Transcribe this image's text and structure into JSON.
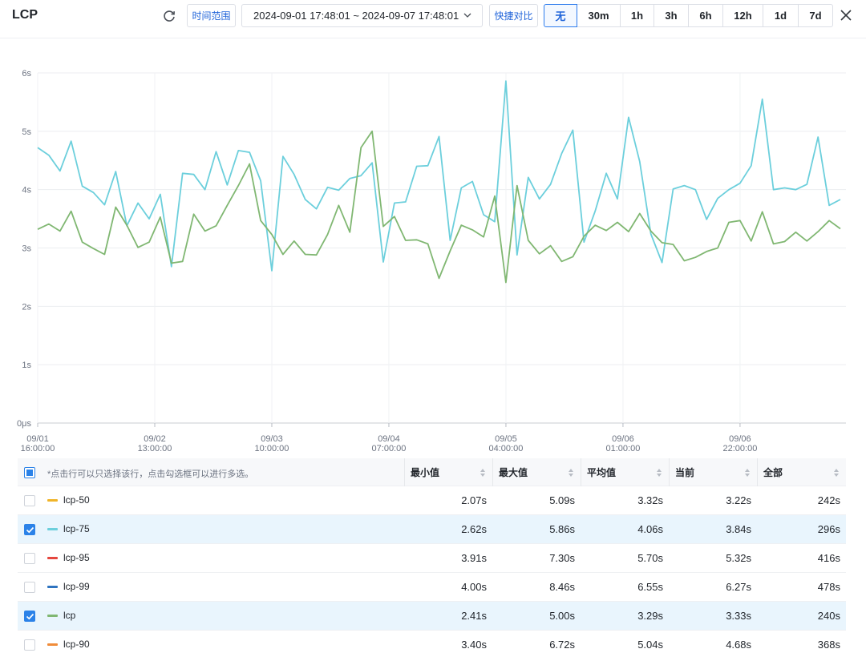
{
  "header": {
    "title": "LCP",
    "time_range_label": "时间范围",
    "range_value": "2024-09-01 17:48:01 ~ 2024-09-07 17:48:01",
    "compare_label": "快捷对比",
    "compare_options": [
      "无",
      "30m",
      "1h",
      "3h",
      "6h",
      "12h",
      "1d",
      "7d"
    ],
    "active_option": "无"
  },
  "chart_data": {
    "type": "line",
    "y_ticks": [
      "0μs",
      "1s",
      "2s",
      "3s",
      "4s",
      "5s",
      "6s"
    ],
    "ylim": [
      0,
      6
    ],
    "x_ticks": [
      {
        "date": "09/01",
        "time": "16:00:00"
      },
      {
        "date": "09/02",
        "time": "13:00:00"
      },
      {
        "date": "09/03",
        "time": "10:00:00"
      },
      {
        "date": "09/04",
        "time": "07:00:00"
      },
      {
        "date": "09/05",
        "time": "04:00:00"
      },
      {
        "date": "09/06",
        "time": "01:00:00"
      },
      {
        "date": "09/06",
        "time": "22:00:00"
      }
    ],
    "x_range_hours": [
      0,
      145
    ],
    "x_interval_hours": 2,
    "grid": true,
    "series": [
      {
        "name": "lcp-75",
        "color": "#6ccfdc",
        "values": [
          4.72,
          4.59,
          4.32,
          4.83,
          4.06,
          3.95,
          3.74,
          4.31,
          3.38,
          3.77,
          3.5,
          3.92,
          2.68,
          4.28,
          4.26,
          4.0,
          4.65,
          4.08,
          4.67,
          4.64,
          4.15,
          2.61,
          4.57,
          4.26,
          3.83,
          3.67,
          4.04,
          3.99,
          4.19,
          4.24,
          4.46,
          2.76,
          3.77,
          3.79,
          4.4,
          4.41,
          4.91,
          3.13,
          4.03,
          4.14,
          3.57,
          3.45,
          5.86,
          2.88,
          4.21,
          3.84,
          4.09,
          4.62,
          5.02,
          3.1,
          3.63,
          4.28,
          3.84,
          5.24,
          4.48,
          3.24,
          2.75,
          4.01,
          4.07,
          4.0,
          3.49,
          3.85,
          4.0,
          4.11,
          4.41,
          5.55,
          4.0,
          4.03,
          4.0,
          4.09,
          4.9,
          3.73,
          3.83
        ]
      },
      {
        "name": "lcp",
        "color": "#80b772",
        "values": [
          3.32,
          3.41,
          3.29,
          3.63,
          3.1,
          2.99,
          2.89,
          3.7,
          3.39,
          3.01,
          3.1,
          3.53,
          2.74,
          2.77,
          3.58,
          3.29,
          3.38,
          3.73,
          4.07,
          4.44,
          3.47,
          3.23,
          2.89,
          3.12,
          2.89,
          2.88,
          3.23,
          3.73,
          3.27,
          4.72,
          5.0,
          3.37,
          3.54,
          3.13,
          3.14,
          3.07,
          2.48,
          2.95,
          3.39,
          3.31,
          3.19,
          3.89,
          2.41,
          4.07,
          3.13,
          2.9,
          3.04,
          2.77,
          2.85,
          3.2,
          3.39,
          3.3,
          3.44,
          3.28,
          3.59,
          3.29,
          3.09,
          3.06,
          2.78,
          2.84,
          2.94,
          3.0,
          3.44,
          3.47,
          3.12,
          3.62,
          3.07,
          3.11,
          3.27,
          3.12,
          3.28,
          3.47,
          3.33
        ]
      }
    ]
  },
  "table": {
    "hint": "*点击行可以只选择该行，点击勾选框可以进行多选。",
    "columns": [
      "最小值",
      "最大值",
      "平均值",
      "当前",
      "全部"
    ],
    "rows": [
      {
        "name": "lcp-50",
        "color": "#f0b429",
        "checked": false,
        "min": "2.07s",
        "max": "5.09s",
        "avg": "3.32s",
        "current": "3.22s",
        "all": "242s"
      },
      {
        "name": "lcp-75",
        "color": "#6ccfdc",
        "checked": true,
        "min": "2.62s",
        "max": "5.86s",
        "avg": "4.06s",
        "current": "3.84s",
        "all": "296s"
      },
      {
        "name": "lcp-95",
        "color": "#e5473f",
        "checked": false,
        "min": "3.91s",
        "max": "7.30s",
        "avg": "5.70s",
        "current": "5.32s",
        "all": "416s"
      },
      {
        "name": "lcp-99",
        "color": "#2f74c0",
        "checked": false,
        "min": "4.00s",
        "max": "8.46s",
        "avg": "6.55s",
        "current": "6.27s",
        "all": "478s"
      },
      {
        "name": "lcp",
        "color": "#80b772",
        "checked": true,
        "min": "2.41s",
        "max": "5.00s",
        "avg": "3.29s",
        "current": "3.33s",
        "all": "240s"
      },
      {
        "name": "lcp-90",
        "color": "#f08c3a",
        "checked": false,
        "min": "3.40s",
        "max": "6.72s",
        "avg": "5.04s",
        "current": "4.68s",
        "all": "368s"
      }
    ]
  }
}
